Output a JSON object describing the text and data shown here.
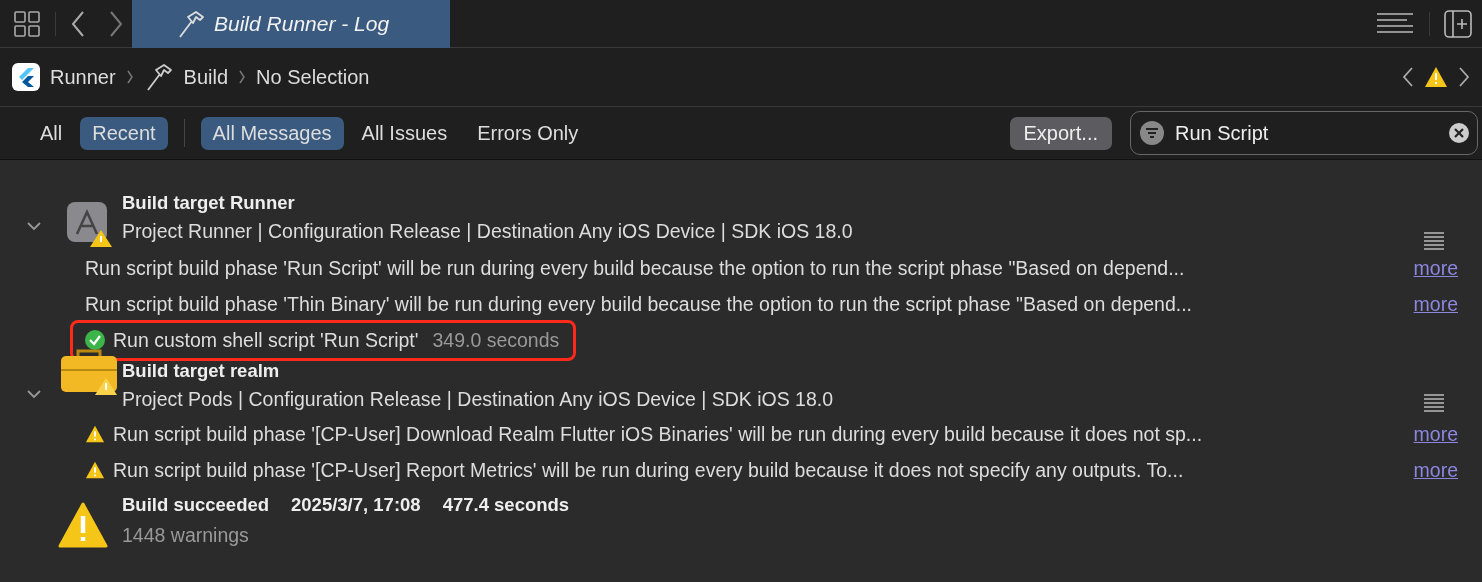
{
  "toolbar": {
    "tab": {
      "title": "Build Runner - Log",
      "selected": true
    }
  },
  "breadcrumb": [
    {
      "label": "Runner"
    },
    {
      "label": "Build"
    },
    {
      "label": "No Selection"
    }
  ],
  "filters": {
    "scope": [
      {
        "label": "All",
        "selected": false
      },
      {
        "label": "Recent",
        "selected": true
      }
    ],
    "messages": [
      {
        "label": "All Messages",
        "selected": true
      },
      {
        "label": "All Issues",
        "selected": false
      },
      {
        "label": "Errors Only",
        "selected": false
      }
    ],
    "export_button": "Export...",
    "search": {
      "value": "Run Script"
    }
  },
  "targets": [
    {
      "title": "Build target Runner",
      "subtitle": "Project Runner | Configuration Release | Destination Any iOS Device | SDK iOS 18.0",
      "expanded": true,
      "messages": [
        {
          "kind": "info",
          "text": "Run script build phase 'Run Script' will be run during every build because the option to run the script phase \"Based on depend...",
          "link": "more",
          "highlighted": false
        },
        {
          "kind": "info",
          "text": "Run script build phase 'Thin Binary' will be run during every build because the option to run the script phase \"Based on depend...",
          "link": "more",
          "highlighted": false
        },
        {
          "kind": "success",
          "text": "Run custom shell script 'Run Script'",
          "duration": "349.0 seconds",
          "highlighted": true
        }
      ]
    },
    {
      "title": "Build target realm",
      "subtitle": "Project Pods | Configuration Release | Destination Any iOS Device | SDK iOS 18.0",
      "expanded": true,
      "messages": [
        {
          "kind": "warning",
          "text": "Run script build phase '[CP-User] Download Realm Flutter iOS Binaries' will be run during every build because it does not sp...",
          "link": "more",
          "highlighted": false
        },
        {
          "kind": "warning",
          "text": "Run script build phase '[CP-User] Report Metrics' will be run during every build because it does not specify any outputs. To...",
          "link": "more",
          "highlighted": false
        }
      ]
    }
  ],
  "summary": {
    "status": "Build succeeded",
    "date": "2025/3/7, 17:08",
    "duration": "477.4 seconds",
    "warnings": "1448 warnings"
  }
}
